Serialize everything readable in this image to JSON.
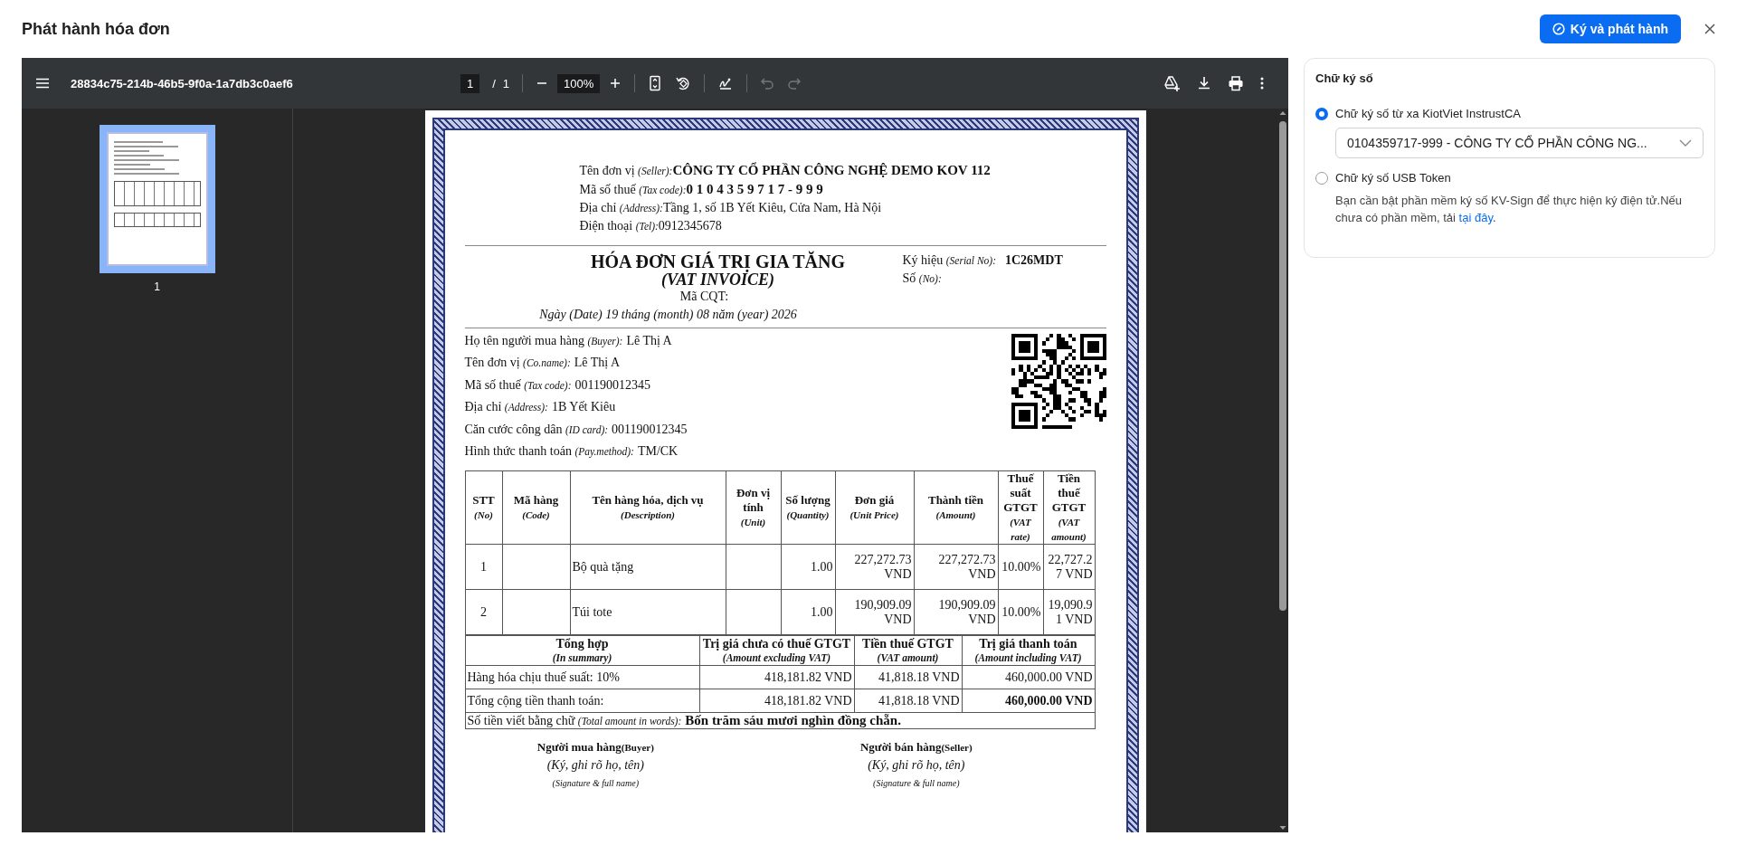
{
  "dialog": {
    "title": "Phát hành hóa đơn",
    "primary_button": "Ký và phát hành"
  },
  "viewer": {
    "file_name": "28834c75-214b-46b5-9f0a-1a7db3c0aef6",
    "page": "1",
    "page_separator": "/",
    "page_count": "1",
    "zoom": "100%",
    "undo_disabled": true,
    "redo_disabled": true,
    "thumbnails": [
      {
        "label": "1",
        "selected": true
      }
    ]
  },
  "invoice": {
    "seller": [
      {
        "label": "Tên đơn vị",
        "label_en": "(Seller):",
        "value": "CÔNG TY CỔ PHẦN CÔNG NGHỆ DEMO KOV 112",
        "bold": true
      },
      {
        "label": "Mã số thuế",
        "label_en": "(Tax code):",
        "value": "0 1 0 4 3 5 9 7 1 7 - 9 9 9",
        "bold": true
      },
      {
        "label": "Địa chỉ",
        "label_en": "(Address):",
        "value": "Tầng 1, số 1B Yết Kiêu, Cửa Nam, Hà Nội",
        "bold": false
      },
      {
        "label": "Điện thoại",
        "label_en": "(Tel):",
        "value": "0912345678",
        "bold": false
      }
    ],
    "title": "HÓA ĐƠN GIÁ TRỊ GIA TĂNG",
    "subtitle": "(VAT INVOICE)",
    "authority_code_label": "Mã CQT:",
    "date": "Ngày (Date) 19 tháng (month) 08 năm (year) 2026",
    "serial": [
      {
        "label": "Ký hiệu",
        "label_en": "(Serial No):",
        "value": "1C26MDT"
      },
      {
        "label": "Số",
        "label_en": "(No):"
      }
    ],
    "buyer": [
      {
        "label": "Họ tên người mua hàng",
        "label_en": "(Buyer):",
        "value": "Lê Thị A"
      },
      {
        "label": "Tên đơn vị",
        "label_en": "(Co.name):",
        "value": "Lê Thị A"
      },
      {
        "label": "Mã số thuế",
        "label_en": "(Tax code):",
        "value": "001190012345"
      },
      {
        "label": "Địa chỉ",
        "label_en": "(Address):",
        "value": "1B Yết Kiêu"
      },
      {
        "label": "Căn cước công dân",
        "label_en": "(ID card):",
        "value": "001190012345"
      },
      {
        "label": "Hình thức thanh toán",
        "label_en": "(Pay.method):",
        "value": "TM/CK"
      }
    ],
    "columns": [
      {
        "label": "STT",
        "label_en": "(No)"
      },
      {
        "label": "Mã hàng",
        "label_en": "(Code)"
      },
      {
        "label": "Tên hàng hóa, dịch vụ",
        "label_en": "(Description)"
      },
      {
        "label": "Đơn vị tính",
        "label_en": "(Unit)"
      },
      {
        "label": "Số lượng",
        "label_en": "(Quantity)"
      },
      {
        "label": "Đơn giá",
        "label_en": "(Unit Price)"
      },
      {
        "label": "Thành tiền",
        "label_en": "(Amount)"
      },
      {
        "label": "Thuế suất GTGT",
        "label_en": "(VAT rate)"
      },
      {
        "label": "Tiền thuế GTGT",
        "label_en": "(VAT amount)"
      }
    ],
    "rows": [
      {
        "no": "1",
        "description": "Bộ quà tặng",
        "quantity": "1.00",
        "unit_price": "227,272.73 VND",
        "amount": "227,272.73 VND",
        "vat_rate": "10.00%",
        "vat_amount": "22,727.27 VND"
      },
      {
        "no": "2",
        "description": "Túi tote",
        "quantity": "1.00",
        "unit_price": "190,909.09 VND",
        "amount": "190,909.09 VND",
        "vat_rate": "10.00%",
        "vat_amount": "19,090.91 VND"
      }
    ],
    "summary_columns": [
      {
        "label": "Tổng hợp",
        "label_en": "(In summary)"
      },
      {
        "label": "Trị giá chưa có thuế GTGT",
        "label_en": "(Amount excluding VAT)"
      },
      {
        "label": "Tiền thuế GTGT",
        "label_en": "(VAT amount)"
      },
      {
        "label": "Trị giá thanh toán",
        "label_en": "(Amount including VAT)"
      }
    ],
    "summary_rows": [
      {
        "kind": "subtotal",
        "label": "Hàng hóa chịu thuế suất: 10%",
        "excluding_vat": "418,181.82 VND",
        "vat": "41,818.18 VND",
        "including_vat": "460,000.00 VND"
      },
      {
        "kind": "total",
        "label": "Tổng cộng tiền thanh toán:",
        "excluding_vat": "418,181.82 VND",
        "vat": "41,818.18 VND",
        "including_vat": "460,000.00 VND"
      }
    ],
    "amount_in_words": {
      "label": "Số tiền viết bằng chữ",
      "label_en": "(Total amount in words):",
      "value": "Bốn trăm sáu mươi nghìn đồng chẵn."
    },
    "signatures": [
      {
        "title": "Người mua hàng",
        "title_en": "(Buyer)",
        "hint": "(Ký, ghi rõ họ, tên)",
        "hint_en": "(Signature & full name)"
      },
      {
        "title": "Người bán hàng",
        "title_en": "(Seller)",
        "hint": "(Ký, ghi rõ họ, tên)",
        "hint_en": "(Signature & full name)"
      }
    ]
  },
  "signature_panel": {
    "title": "Chữ ký số",
    "options": [
      {
        "label": "Chữ ký số từ xa KiotViet InstrustCA",
        "selected": true,
        "select_value": "0104359717-999 - CÔNG TY CỔ PHẦN CÔNG NG..."
      },
      {
        "label": "Chữ ký số USB Token",
        "selected": false,
        "note": "Bạn cần bật phần mềm ký số KV-Sign để thực hiện ký điện tử.Nếu chưa có phần mềm, tải ",
        "link": "tại đây",
        "note_end": "."
      }
    ]
  }
}
